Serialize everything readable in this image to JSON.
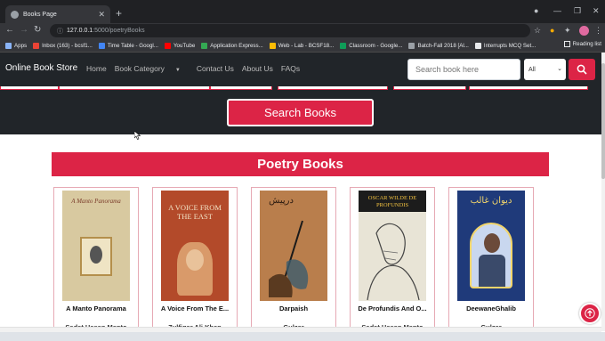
{
  "browser": {
    "tab_title": "Books Page",
    "url_host": "127.0.0.1",
    "url_path": ":5000/poetryBooks",
    "bookmarks": [
      {
        "label": "Apps",
        "color": "#8ab4f8"
      },
      {
        "label": "Inbox (163) - bcsf1...",
        "color": "#ea4335"
      },
      {
        "label": "Time Table - Googl...",
        "color": "#4285f4"
      },
      {
        "label": "YouTube",
        "color": "#ff0000"
      },
      {
        "label": "Application Express...",
        "color": "#34a853"
      },
      {
        "label": "Web - Lab - BCSF18...",
        "color": "#fbbc05"
      },
      {
        "label": "Classroom - Google...",
        "color": "#0f9d58"
      },
      {
        "label": "Batch-Fall 2018 [Al...",
        "color": "#9aa0a6"
      },
      {
        "label": "Interrupts MCQ Set...",
        "color": "#e8eaed"
      }
    ],
    "reading_list": "Reading list"
  },
  "navbar": {
    "brand": "Online Book Store",
    "links": [
      "Home",
      "Book Category",
      "Contact Us",
      "About Us",
      "FAQs"
    ],
    "search_placeholder": "Search book here",
    "category_value": "All"
  },
  "main": {
    "search_button": "Search Books",
    "section_title": "Poetry Books",
    "books": [
      {
        "title": "A Manto Panorama",
        "author": "Sadat Hasan Manto",
        "cover_text": "A Manto Panorama",
        "cover_color": "#d8c9a0"
      },
      {
        "title": "A Voice From The E...",
        "author": "Zulfiqar Ali Khan",
        "cover_text": "A VOICE FROM THE EAST",
        "cover_color": "#b34a2a"
      },
      {
        "title": "Darpaish",
        "author": "Gulzar",
        "cover_text": "درپیش",
        "cover_color": "#4a2a18"
      },
      {
        "title": "De Profundis And O...",
        "author": "Sadat Hasan Manto",
        "cover_text": "OSCAR WILDE DE PROFUNDIS",
        "cover_color": "#1c1c1c"
      },
      {
        "title": "DeewaneGhalib",
        "author": "Gulzar",
        "cover_text": "دیوان غالب",
        "cover_color": "#1f3a7a"
      }
    ]
  },
  "colors": {
    "accent": "#dc2446",
    "nav": "#212529"
  }
}
